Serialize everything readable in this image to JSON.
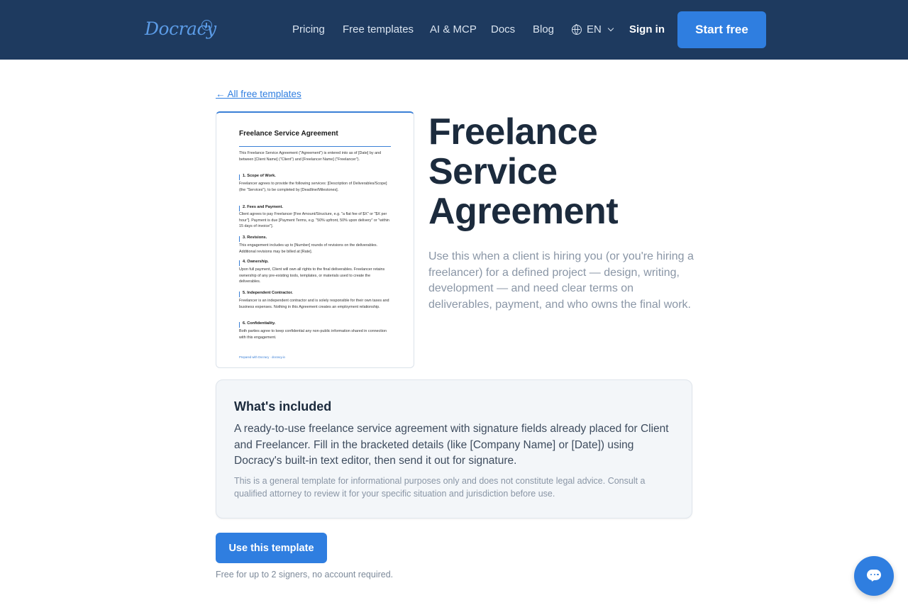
{
  "header": {
    "logo_text": "Docracy",
    "nav": [
      "Pricing",
      "Free templates",
      "AI & MCP",
      "Docs",
      "Blog"
    ],
    "language": "EN",
    "sign_in": "Sign in",
    "start_free": "Start free"
  },
  "back_link": "← All free templates",
  "preview": {
    "title": "Freelance Service Agreement",
    "intro": "This Freelance Service Agreement (\"Agreement\") is entered into as of [Date] by and between [Client Name] (\"Client\") and [Freelancer Name] (\"Freelancer\").",
    "sections": [
      {
        "heading": "1. Scope of Work.",
        "text": "Freelancer agrees to provide the following services: [Description of Deliverables/Scope] (the \"Services\"), to be completed by [Deadline/Milestones]."
      },
      {
        "heading": "2. Fees and Payment.",
        "text": "Client agrees to pay Freelancer [Fee Amount/Structure, e.g. \"a flat fee of $X\" or \"$X per hour\"]. Payment is due [Payment Terms, e.g. \"50% upfront, 50% upon delivery\" or \"within 15 days of invoice\"]."
      },
      {
        "heading": "3. Revisions.",
        "text": "This engagement includes up to [Number] rounds of revisions on the deliverables. Additional revisions may be billed at [Rate]."
      },
      {
        "heading": "4. Ownership.",
        "text": "Upon full payment, Client will own all rights to the final deliverables. Freelancer retains ownership of any pre-existing tools, templates, or materials used to create the deliverables."
      },
      {
        "heading": "5. Independent Contractor.",
        "text": "Freelancer is an independent contractor and is solely responsible for their own taxes and business expenses. Nothing in this Agreement creates an employment relationship."
      },
      {
        "heading": "6. Confidentiality.",
        "text": "Both parties agree to keep confidential any non-public information shared in connection with this engagement."
      }
    ],
    "footer": "Prepared with Docracy · docracy.io"
  },
  "title_lines": [
    "Freelance",
    "Service",
    "Agreement"
  ],
  "description": "Use this when a client is hiring you (or you're hiring a freelancer) for a defined project — design, writing, development — and need clear terms on deliverables, payment, and who owns the final work.",
  "included": {
    "title": "What's included",
    "text": "A ready-to-use freelance service agreement with signature fields already placed for Client and Freelancer. Fill in the bracketed details (like [Company Name] or [Date]) using Docracy's built-in text editor, then send it out for signature.",
    "note": "This is a general template for informational purposes only and does not constitute legal advice. Consult a qualified attorney to review it for your specific situation and jurisdiction before use."
  },
  "use_button": "Use this template",
  "free_note": "Free for up to 2 signers, no account required.",
  "icons": {
    "globe": "globe-icon",
    "chevron": "chevron-down-icon",
    "chat": "chat-bubble-icon"
  },
  "colors": {
    "header_bg": "#1e3a5f",
    "accent": "#2f7ee0"
  }
}
